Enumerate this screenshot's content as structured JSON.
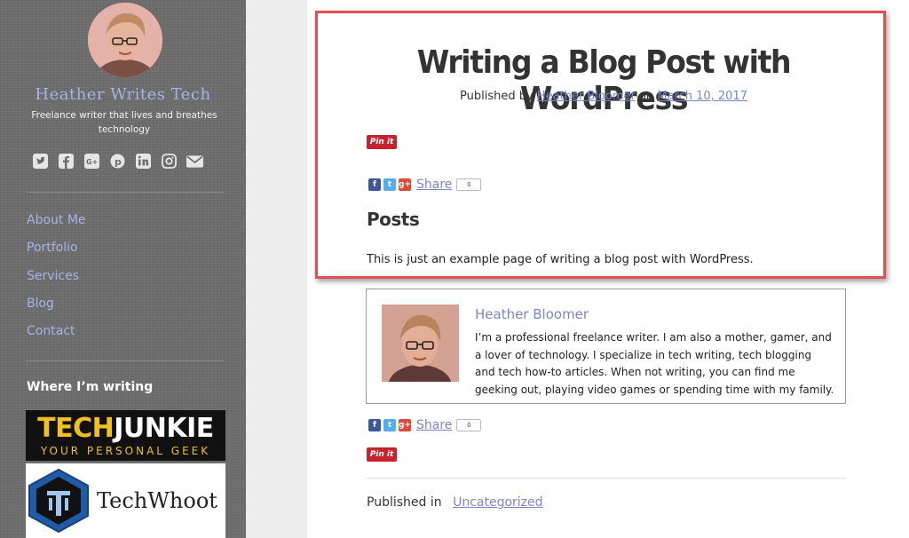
{
  "sidebar": {
    "site_title": "Heather Writes Tech",
    "tagline": "Freelance writer that lives and breathes technology",
    "social_icons": [
      "twitter-icon",
      "facebook-icon",
      "google-plus-icon",
      "pinterest-icon",
      "linkedin-icon",
      "instagram-icon",
      "email-icon"
    ],
    "nav": [
      {
        "label": "About Me"
      },
      {
        "label": "Portfolio"
      },
      {
        "label": "Services"
      },
      {
        "label": "Blog"
      },
      {
        "label": "Contact"
      }
    ],
    "widget_title": "Where I’m writing",
    "logos": {
      "techjunkie_a": "TECH",
      "techjunkie_b": "JUNKIE",
      "techjunkie_tagline": "YOUR PERSONAL GEEK",
      "techwhoot": "TechWhoot"
    }
  },
  "post": {
    "title": "Writing a Blog Post with WordPress",
    "byline_prefix": "Published by",
    "author": "Heather Bloomer",
    "byline_on": "on",
    "date": "March 10, 2017",
    "pin_label": "Pin it",
    "share_label": "Share",
    "share_count": "0",
    "category_heading": "Posts",
    "body": "This is just an example page of writing a blog post with WordPress.",
    "author_box": {
      "name": "Heather Bloomer",
      "bio": "I’m a professional freelance writer. I am also a mother, gamer, and a lover of technology. I specialize in tech writing, tech blogging and tech how-to articles. When not writing, you can find me geeking out, playing video games or spending time with my family."
    },
    "published_in_label": "Published in",
    "published_in_value": "Uncategorized"
  },
  "colors": {
    "link": "#7b85c9",
    "highlight_border": "#e05050",
    "pinterest": "#c8232c"
  }
}
